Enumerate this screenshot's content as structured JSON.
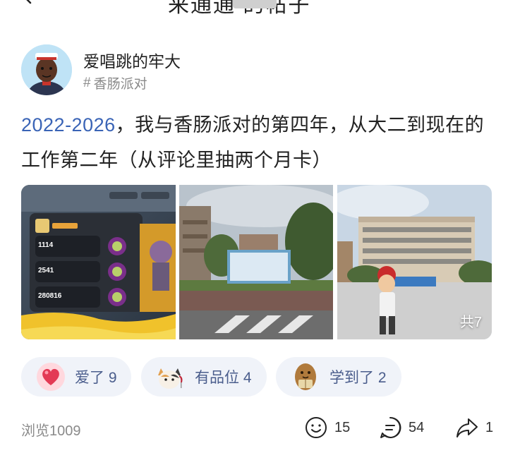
{
  "header": {
    "title_partial": "来通通   的帖子"
  },
  "author": {
    "name": "爱唱跳的牢大",
    "topic": "香肠派对"
  },
  "post": {
    "link_text": "2022-2026",
    "text": "，我与香肠派对的第四年，从大二到现在的工作第二年（从评论里抽两个月卡）"
  },
  "images": {
    "game_stats": [
      "1114",
      "2541",
      "280816"
    ],
    "count_badge": "共7"
  },
  "reactions": [
    {
      "icon": "heart-icon",
      "label": "爱了 9"
    },
    {
      "icon": "cat-wine-icon",
      "label": "有品位 4"
    },
    {
      "icon": "potato-book-icon",
      "label": "学到了 2"
    }
  ],
  "footer": {
    "views": "浏览1009",
    "like_count": "15",
    "comment_count": "54",
    "share_count": "1"
  },
  "colors": {
    "link": "#3a64b6",
    "reaction_bg": "#f0f3f9",
    "reaction_text": "#4a5d8c"
  }
}
